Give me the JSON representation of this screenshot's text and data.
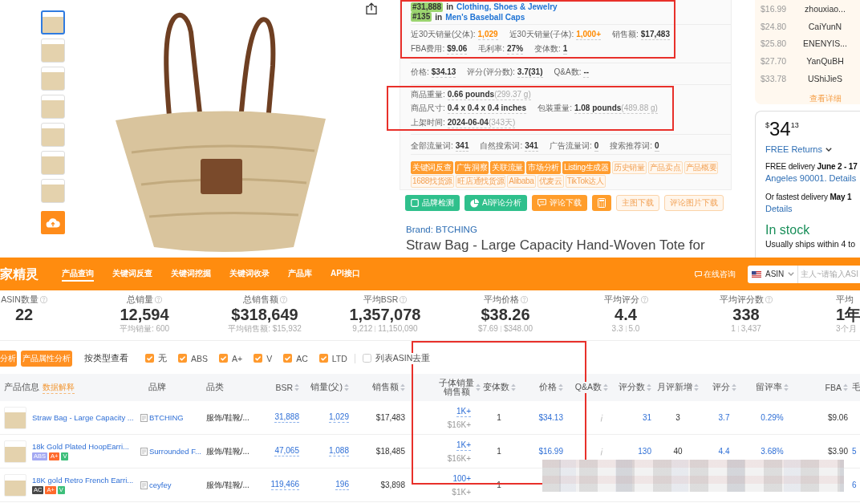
{
  "gallery": {
    "thumbnails": [
      {
        "selected": true
      },
      {
        "selected": false
      },
      {
        "selected": false
      },
      {
        "selected": false
      },
      {
        "selected": false
      },
      {
        "selected": false
      },
      {
        "selected": false
      }
    ]
  },
  "product_panel": {
    "ranks": [
      {
        "rank": "#31,888",
        "in": "in",
        "category": "Clothing, Shoes & Jewelry"
      },
      {
        "rank": "#135",
        "in": "in",
        "category": "Men's Baseball Caps"
      }
    ],
    "groups": [
      [
        [
          {
            "label": "近30天销量(父体):",
            "value": "1,029",
            "kind": "highlight"
          },
          {
            "label": "近30天销量(子体):",
            "value": "1,000+",
            "kind": "highlight"
          },
          {
            "label": "销售额:",
            "value": "$17,483",
            "kind": "plain"
          }
        ],
        [
          {
            "label": "FBA费用:",
            "value": "$9.06",
            "kind": "plain"
          },
          {
            "label": "毛利率:",
            "value": "27%",
            "kind": "plain"
          },
          {
            "label": "变体数:",
            "value": "1",
            "kind": "plain"
          }
        ]
      ],
      [
        [
          {
            "label": "价格:",
            "value": "$34.13",
            "kind": "plain"
          },
          {
            "label": "评分(评分数):",
            "value": "3.7(31)",
            "kind": "plain"
          },
          {
            "label": "Q&A数:",
            "value": "--",
            "kind": "plain"
          }
        ]
      ],
      [
        [
          {
            "label": "商品重量:",
            "value": "0.66 pounds",
            "note": "(299.37 g)",
            "kind": "plain"
          }
        ],
        [
          {
            "label": "商品尺寸:",
            "value": "0.4 x 0.4 x 0.4 inches",
            "kind": "plain"
          },
          {
            "label": "包装重量:",
            "value": "1.08 pounds",
            "note": "(489.88 g)",
            "kind": "plain"
          }
        ],
        [
          {
            "label": "上架时间:",
            "value": "2024-06-04",
            "note": "(343天)",
            "kind": "plain"
          }
        ]
      ],
      [
        [
          {
            "label": "全部流量词:",
            "value": "341",
            "kind": "plain"
          },
          {
            "label": "自然搜索词:",
            "value": "341",
            "kind": "plain"
          },
          {
            "label": "广告流量词:",
            "value": "0",
            "kind": "plain"
          },
          {
            "label": "搜索推荐词:",
            "value": "0",
            "kind": "plain"
          }
        ]
      ]
    ],
    "tools": [
      {
        "label": "关键词反查",
        "kind": "filled"
      },
      {
        "label": "广告洞察",
        "kind": "filled"
      },
      {
        "label": "关联流量",
        "kind": "filled"
      },
      {
        "label": "市场分析",
        "kind": "filled"
      },
      {
        "label": "Listing生成器",
        "kind": "filled"
      },
      {
        "label": "历史销量",
        "kind": "outline"
      },
      {
        "label": "产品卖点",
        "kind": "outline"
      },
      {
        "label": "产品概要",
        "kind": "outline"
      },
      {
        "label": "1688找货源",
        "kind": "outline"
      },
      {
        "label": "旺店通找货源",
        "kind": "outline"
      },
      {
        "label": "Alibaba",
        "kind": "outline"
      },
      {
        "label": "优麦云",
        "kind": "outline"
      },
      {
        "label": "TikTok达人",
        "kind": "outline"
      }
    ]
  },
  "actions": [
    {
      "label": "品牌检测",
      "kind": "success"
    },
    {
      "label": "AI评论分析",
      "kind": "success"
    },
    {
      "label": "评论下载",
      "kind": "warning"
    },
    {
      "kind": "warning"
    },
    {
      "label": "主图下载",
      "kind": "outline"
    },
    {
      "label": "评论图片下载",
      "kind": "outline"
    }
  ],
  "brand": "Brand: BTCHING",
  "title": "Straw Bag - Large Capacity Hand-Woven Tote for",
  "offers": {
    "rows": [
      {
        "price": "$16.99",
        "seller": "zhouxiao..."
      },
      {
        "price": "$24.80",
        "seller": "CaiYunN"
      },
      {
        "price": "$25.80",
        "seller": "ENENYIS..."
      },
      {
        "price": "$27.70",
        "seller": "YanQuBH"
      },
      {
        "price": "$33.78",
        "seller": "UShiJieS"
      }
    ],
    "more": "查看详细"
  },
  "buy_box": {
    "price": {
      "symbol": "$",
      "whole": "34",
      "fraction": "13"
    },
    "returns": "FREE Returns",
    "delivery": "FREE delivery **June 2 - 17**",
    "delivery_link": "Angeles 90001. Details",
    "fastest": "Or fastest delivery **May 1**",
    "fastest_link": "Details",
    "stock": "In stock",
    "shipping": "Usually ships within 4 to"
  },
  "toolbar": {
    "logo": "家精灵",
    "tabs": [
      {
        "label": "产品查询",
        "selected": true
      },
      {
        "label": "关键词反查",
        "selected": false
      },
      {
        "label": "关键词挖掘",
        "selected": false
      },
      {
        "label": "关键词收录",
        "selected": false
      },
      {
        "label": "产品库",
        "selected": false
      },
      {
        "label": "API接口",
        "selected": false
      }
    ],
    "consult": "在线咨询",
    "search": {
      "type": "ASIN",
      "placeholder": "主人~请输入ASI"
    }
  },
  "stats": [
    {
      "label": "ASIN数量",
      "value": "22",
      "hint": true
    },
    {
      "label": "总销量",
      "value": "12,594",
      "sub": "平均销量: 600",
      "hint": true
    },
    {
      "label": "总销售额",
      "value": "$318,649",
      "sub": "平均销售额: $15,932",
      "hint": true
    },
    {
      "label": "平均BSR",
      "value": "1,357,078",
      "range": [
        "9,212",
        "11,150,090"
      ],
      "hint": true
    },
    {
      "label": "平均价格",
      "value": "$38.26",
      "range": [
        "$7.69",
        "$348.00"
      ],
      "hint": true
    },
    {
      "label": "平均评分",
      "value": "4.4",
      "range": [
        "3.3",
        "5.0"
      ],
      "hint": true
    },
    {
      "label": "平均评分数",
      "value": "338",
      "range": [
        "1",
        "3,437"
      ],
      "hint": true
    },
    {
      "label": "平均",
      "value": "1年",
      "sub": "3个月",
      "hint": false
    }
  ],
  "filters": {
    "buttons": [
      "分析",
      "产品属性分析"
    ],
    "label": "按类型查看",
    "types": [
      {
        "label": "无",
        "checked": true
      },
      {
        "label": "ABS",
        "checked": true
      },
      {
        "label": "A+",
        "checked": true
      },
      {
        "label": "V",
        "checked": true
      },
      {
        "label": "AC",
        "checked": true
      },
      {
        "label": "LTD",
        "checked": true
      }
    ],
    "dedupe": {
      "label": "列表ASIN去重",
      "checked": false
    }
  },
  "table": {
    "columns": [
      {
        "label": "产品信息",
        "note": "数据解释",
        "sortable": false
      },
      {
        "label": "品牌",
        "sortable": false
      },
      {
        "label": "品类",
        "sortable": false
      },
      {
        "label": "BSR",
        "sortable": true
      },
      {
        "label": "销量(父)",
        "sortable": true
      },
      {
        "label": "销售额",
        "sortable": true
      },
      {
        "label": "子体销量",
        "label_2": "销售额",
        "sortable": true
      },
      {
        "label": "变体数",
        "sortable": true
      },
      {
        "label": "价格",
        "sortable": true
      },
      {
        "label": "Q&A数",
        "sortable": true
      },
      {
        "label": "评分数",
        "sortable": true
      },
      {
        "label": "月评新增",
        "sortable": true
      },
      {
        "label": "评分",
        "sortable": true
      },
      {
        "label": "留评率",
        "sortable": true
      },
      {
        "label": "FBA",
        "sortable": true
      },
      {
        "label": "毛",
        "sortable": false
      }
    ],
    "rows": [
      {
        "title": "Straw Bag - Large Capacity ...",
        "brand": "BTCHING",
        "category": "服饰/鞋靴/...",
        "bsr": "31,888",
        "sales": "1,029",
        "revenue": "$17,483",
        "child_sales": "1K+",
        "child_revenue": "$16K+",
        "variants": "1",
        "price": "$34.13",
        "qa_info": true,
        "reviews": "31",
        "new_reviews": "3",
        "rating": "3.7",
        "review_rate": "0.29%",
        "fba": "$9.06"
      },
      {
        "title": "18k Gold Plated HoopEarri...",
        "tags": [
          {
            "label": "ABS",
            "color": "#a4a9f2"
          },
          {
            "label": "A+",
            "color": "#ff6a2c"
          },
          {
            "label": "V",
            "color": "#3dbf7a"
          }
        ],
        "brand": "Surrounded F...",
        "category": "服饰/鞋靴/...",
        "bsr": "47,065",
        "sales": "1,088",
        "revenue": "$18,485",
        "child_sales": "1K+",
        "child_revenue": "$16K+",
        "variants": "1",
        "price": "$16.99",
        "qa_info": true,
        "reviews": "130",
        "new_reviews": "40",
        "rating": "4.4",
        "review_rate": "3.68%",
        "fba": "$3.90",
        "column_16": "5"
      },
      {
        "title": "18K gold Retro French Earri...",
        "tags": [
          {
            "label": "AC",
            "color": "#474747"
          },
          {
            "label": "A+",
            "color": "#ff6a2c"
          },
          {
            "label": "V",
            "color": "#3dbf7a"
          }
        ],
        "brand": "ceyfey",
        "category": "服饰/鞋靴/...",
        "bsr": "119,466",
        "sales": "196",
        "revenue": "$3,898",
        "child_sales": "100+",
        "child_revenue": "$1K+",
        "variants": "1",
        "column_16": "6"
      }
    ]
  }
}
